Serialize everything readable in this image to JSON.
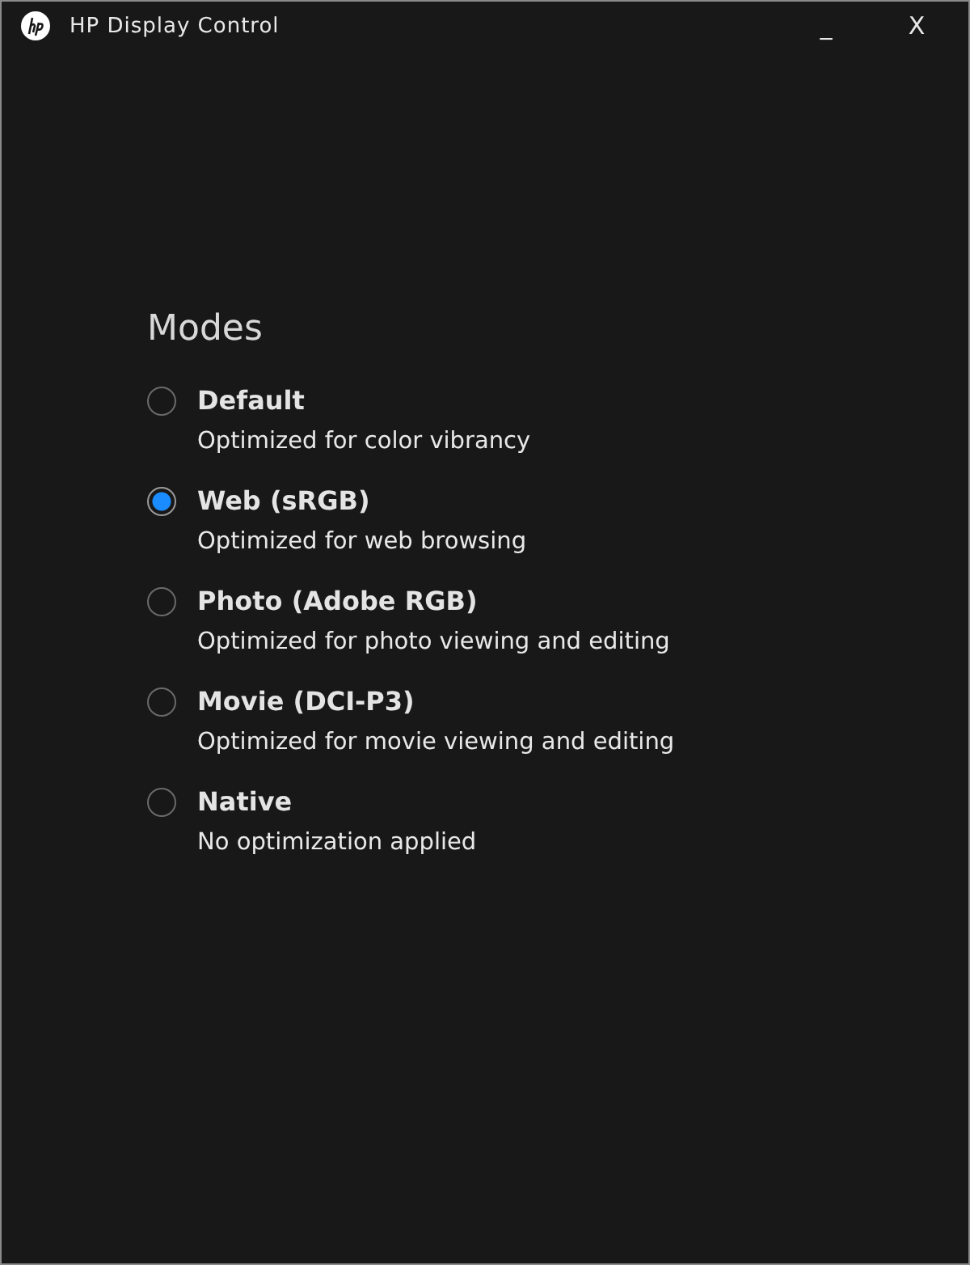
{
  "window": {
    "title": "HP Display Control",
    "controls": [
      "_",
      "X"
    ]
  },
  "section": {
    "heading": "Modes"
  },
  "modes": [
    {
      "label": "Default",
      "description": "Optimized for color vibrancy",
      "selected": false
    },
    {
      "label": "Web (sRGB)",
      "description": "Optimized for web browsing",
      "selected": true
    },
    {
      "label": "Photo (Adobe RGB)",
      "description": "Optimized for photo viewing and editing",
      "selected": false
    },
    {
      "label": "Movie (DCI-P3)",
      "description": "Optimized for movie viewing and editing",
      "selected": false
    },
    {
      "label": "Native",
      "description": "No optimization applied",
      "selected": false
    }
  ]
}
